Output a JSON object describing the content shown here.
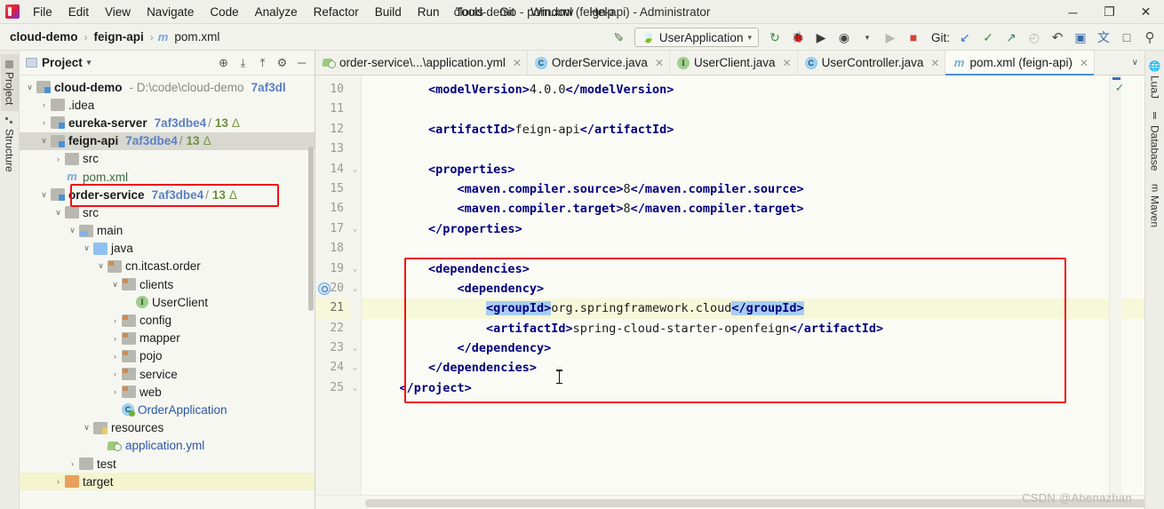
{
  "window": {
    "title": "cloud-demo - pom.xml (feign-api) - Administrator",
    "minimize": "─",
    "maximize": "❐",
    "close": "✕"
  },
  "menu": {
    "items": [
      "File",
      "Edit",
      "View",
      "Navigate",
      "Code",
      "Analyze",
      "Refactor",
      "Build",
      "Run",
      "Tools",
      "Git",
      "Window",
      "Help"
    ]
  },
  "breadcrumb": {
    "project": "cloud-demo",
    "module": "feign-api",
    "file": "pom.xml",
    "file_icon": "m",
    "sep": "›"
  },
  "toolbar": {
    "build_icon": "✐",
    "run_config": "UserApplication",
    "caret": "▾",
    "run_icon": "▶",
    "rerun_icon": "↻",
    "debug_icon": "🐞",
    "run_with_coverage_icon": "▶",
    "profile_icon": "◉",
    "stop_icon": "■",
    "git_label": "Git:",
    "git_update_icon": "↙",
    "git_commit_icon": "✓",
    "git_push_icon": "↗",
    "git_history_icon": "◴",
    "git_rollback_icon": "↶",
    "layout_icon": "▣",
    "translate_icon": "文",
    "terminal_icon": "□",
    "search_icon": "⚲"
  },
  "left_strip": {
    "tabs": [
      {
        "label": "Project",
        "selected": true
      },
      {
        "label": "Structure",
        "selected": false
      }
    ]
  },
  "right_strip": {
    "tabs": [
      {
        "label": "LuaJ",
        "icon": "🌐"
      },
      {
        "label": "Database",
        "icon": "‖"
      },
      {
        "label": "Maven",
        "icon": "m"
      }
    ]
  },
  "project_panel": {
    "title": "Project",
    "tools": {
      "locate": "⊕",
      "expand_all": "⤓",
      "collapse_all": "⤒",
      "settings": "⚙",
      "hide": "─"
    },
    "tree": [
      {
        "indent": 0,
        "arrow": "∨",
        "icon": "module",
        "label": "cloud-demo",
        "bold": true,
        "path": "- D:\\code\\cloud-demo",
        "hash": "7af3dl"
      },
      {
        "indent": 1,
        "arrow": "›",
        "icon": "folder",
        "label": ".idea",
        "bold": false
      },
      {
        "indent": 1,
        "arrow": "›",
        "icon": "module",
        "label": "eureka-server",
        "bold": true,
        "hash": "7af3dbe4",
        "slash": "/",
        "count": "13",
        "tri": "Δ"
      },
      {
        "indent": 1,
        "arrow": "∨",
        "icon": "module",
        "label": "feign-api",
        "bold": true,
        "hash": "7af3dbe4",
        "slash": "/",
        "count": "13",
        "tri": "Δ",
        "selected": true
      },
      {
        "indent": 2,
        "arrow": "›",
        "icon": "folder",
        "label": "src",
        "bold": false
      },
      {
        "indent": 2,
        "arrow": "",
        "icon": "maven",
        "label": "pom.xml",
        "bold": false,
        "green": true
      },
      {
        "indent": 1,
        "arrow": "∨",
        "icon": "module",
        "label": "order-service",
        "bold": true,
        "hash": "7af3dbe4",
        "slash": "/",
        "count": "13",
        "tri": "Δ"
      },
      {
        "indent": 2,
        "arrow": "∨",
        "icon": "folder",
        "label": "src",
        "bold": false
      },
      {
        "indent": 3,
        "arrow": "∨",
        "icon": "srcfolder",
        "label": "main",
        "bold": false
      },
      {
        "indent": 4,
        "arrow": "∨",
        "icon": "bluefolder",
        "label": "java",
        "bold": false
      },
      {
        "indent": 5,
        "arrow": "∨",
        "icon": "pkg",
        "label": "cn.itcast.order",
        "bold": false
      },
      {
        "indent": 6,
        "arrow": "∨",
        "icon": "pkg",
        "label": "clients",
        "bold": false
      },
      {
        "indent": 7,
        "arrow": "",
        "icon": "iface",
        "label": "UserClient",
        "bold": false
      },
      {
        "indent": 6,
        "arrow": "›",
        "icon": "pkg",
        "label": "config",
        "bold": false
      },
      {
        "indent": 6,
        "arrow": "›",
        "icon": "pkg",
        "label": "mapper",
        "bold": false
      },
      {
        "indent": 6,
        "arrow": "›",
        "icon": "pkg",
        "label": "pojo",
        "bold": false
      },
      {
        "indent": 6,
        "arrow": "›",
        "icon": "pkg",
        "label": "service",
        "bold": false
      },
      {
        "indent": 6,
        "arrow": "›",
        "icon": "pkg",
        "label": "web",
        "bold": false
      },
      {
        "indent": 6,
        "arrow": "",
        "icon": "springclass",
        "label": "OrderApplication",
        "bold": false,
        "blue": true
      },
      {
        "indent": 4,
        "arrow": "∨",
        "icon": "resfolder",
        "label": "resources",
        "bold": false
      },
      {
        "indent": 5,
        "arrow": "",
        "icon": "yml",
        "label": "application.yml",
        "bold": false,
        "blue": true
      },
      {
        "indent": 3,
        "arrow": "›",
        "icon": "folder",
        "label": "test",
        "bold": false
      },
      {
        "indent": 2,
        "arrow": "›",
        "icon": "orange",
        "label": "target",
        "bold": false,
        "hl": true
      }
    ]
  },
  "editor": {
    "tabs": [
      {
        "label": "order-service\\...\\application.yml",
        "icon": "yml",
        "icon_char": "",
        "active": false,
        "closeable": true
      },
      {
        "label": "OrderService.java",
        "icon": "c",
        "icon_char": "C",
        "active": false,
        "closeable": true
      },
      {
        "label": "UserClient.java",
        "icon": "i",
        "icon_char": "I",
        "active": false,
        "closeable": true
      },
      {
        "label": "UserController.java",
        "icon": "c",
        "icon_char": "C",
        "active": false,
        "closeable": true
      },
      {
        "label": "pom.xml (feign-api)",
        "icon": "m",
        "icon_char": "m",
        "active": true,
        "closeable": true
      }
    ],
    "tab_overflow": "∨",
    "inspection_ok": "✓",
    "gutter_maven_reload": "↻",
    "lines": [
      {
        "num": "10",
        "indent": 2,
        "segments": [
          {
            "t": "tag",
            "s": "<modelVersion>"
          },
          {
            "t": "txt",
            "s": "4.0.0"
          },
          {
            "t": "tag",
            "s": "</modelVersion>"
          }
        ]
      },
      {
        "num": "11",
        "indent": 0,
        "segments": []
      },
      {
        "num": "12",
        "indent": 2,
        "segments": [
          {
            "t": "tag",
            "s": "<artifactId>"
          },
          {
            "t": "txt",
            "s": "feign-api"
          },
          {
            "t": "tag",
            "s": "</artifactId>"
          }
        ]
      },
      {
        "num": "13",
        "indent": 0,
        "segments": []
      },
      {
        "num": "14",
        "indent": 2,
        "fold": true,
        "segments": [
          {
            "t": "tag",
            "s": "<properties>"
          }
        ]
      },
      {
        "num": "15",
        "indent": 3,
        "segments": [
          {
            "t": "tag",
            "s": "<maven.compiler.source>"
          },
          {
            "t": "txt",
            "s": "8"
          },
          {
            "t": "tag",
            "s": "</maven.compiler.source>"
          }
        ]
      },
      {
        "num": "16",
        "indent": 3,
        "segments": [
          {
            "t": "tag",
            "s": "<maven.compiler.target>"
          },
          {
            "t": "txt",
            "s": "8"
          },
          {
            "t": "tag",
            "s": "</maven.compiler.target>"
          }
        ]
      },
      {
        "num": "17",
        "indent": 2,
        "fold": true,
        "segments": [
          {
            "t": "tag",
            "s": "</properties>"
          }
        ]
      },
      {
        "num": "18",
        "indent": 0,
        "segments": []
      },
      {
        "num": "19",
        "indent": 2,
        "fold": true,
        "segments": [
          {
            "t": "tag",
            "s": "<dependencies>"
          }
        ]
      },
      {
        "num": "20",
        "indent": 3,
        "fold": true,
        "marker": true,
        "segments": [
          {
            "t": "tag",
            "s": "<dependency>"
          }
        ]
      },
      {
        "num": "21",
        "indent": 4,
        "current": true,
        "segments": [
          {
            "t": "tagsel",
            "s": "<groupId>"
          },
          {
            "t": "txt",
            "s": "org.springframework.cloud"
          },
          {
            "t": "tagsel",
            "s": "</groupId>"
          }
        ]
      },
      {
        "num": "22",
        "indent": 4,
        "segments": [
          {
            "t": "tag",
            "s": "<artifactId>"
          },
          {
            "t": "txt",
            "s": "spring-cloud-starter-openfeign"
          },
          {
            "t": "tag",
            "s": "</artifactId>"
          }
        ]
      },
      {
        "num": "23",
        "indent": 3,
        "fold": true,
        "segments": [
          {
            "t": "tag",
            "s": "</dependency>"
          }
        ]
      },
      {
        "num": "24",
        "indent": 2,
        "fold": true,
        "segments": [
          {
            "t": "tag",
            "s": "</dependencies>"
          }
        ]
      },
      {
        "num": "25",
        "indent": 1,
        "fold": true,
        "segments": [
          {
            "t": "tag",
            "s": "</project>"
          }
        ]
      }
    ]
  },
  "watermark": "CSDN @Abenazhan"
}
